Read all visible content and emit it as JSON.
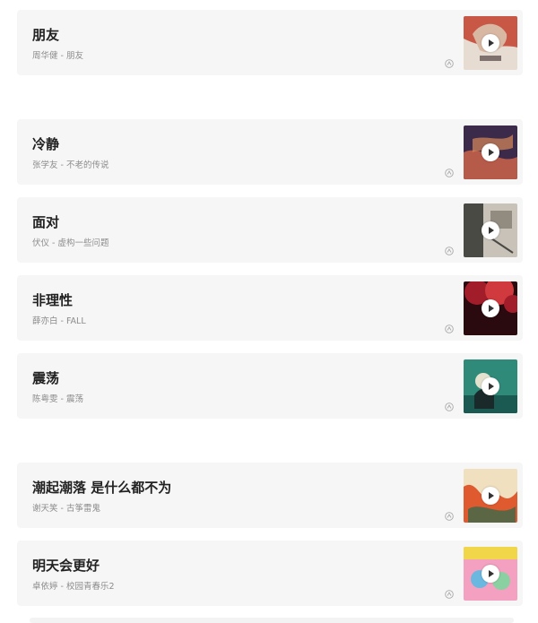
{
  "songs": [
    {
      "title": "朋友",
      "subtitle": "周华健 - 朋友",
      "cover_colors": [
        "#d9b8a3",
        "#c2402e",
        "#e8e0d8"
      ],
      "icon": "music-source-icon"
    },
    {
      "title": "冷静",
      "subtitle": "张学友 - 不老的传说",
      "cover_colors": [
        "#3b2a4a",
        "#b65a4a",
        "#d88a5a"
      ],
      "icon": "music-source-icon"
    },
    {
      "title": "面对",
      "subtitle": "伏仪 - 虚构一些问题",
      "cover_colors": [
        "#4a4a44",
        "#c8c2b8",
        "#7a7468"
      ],
      "icon": "music-source-icon"
    },
    {
      "title": "非理性",
      "subtitle": "薛亦白 - FALL",
      "cover_colors": [
        "#a21d2a",
        "#d03a3e",
        "#2a0a0e"
      ],
      "icon": "music-source-icon"
    },
    {
      "title": "震荡",
      "subtitle": "陈粤雯 - 震荡",
      "cover_colors": [
        "#2f8a7a",
        "#1a5a52",
        "#e4e2cf"
      ],
      "icon": "music-source-icon"
    },
    {
      "title": "潮起潮落 是什么都不为",
      "subtitle": "谢天笑 - 古筝雷鬼",
      "cover_colors": [
        "#f0e0c0",
        "#e05a30",
        "#3a6a4a"
      ],
      "icon": "music-source-icon"
    },
    {
      "title": "明天会更好",
      "subtitle": "卓依婷 - 校园青春乐2",
      "cover_colors": [
        "#f4a0c0",
        "#6ab8e0",
        "#f2d64a"
      ],
      "icon": "music-source-icon"
    }
  ]
}
